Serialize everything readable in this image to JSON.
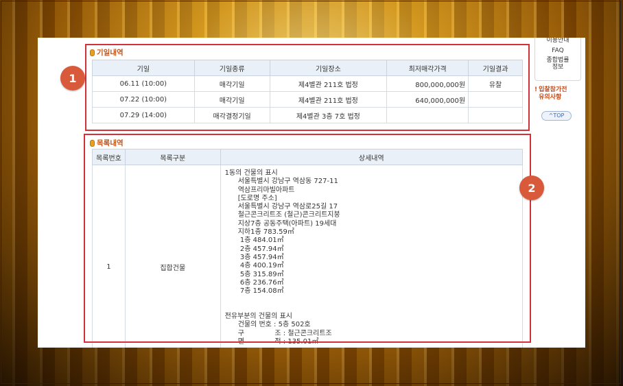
{
  "schedule": {
    "title": "기일내역",
    "headers": [
      "기일",
      "기일종류",
      "기일장소",
      "최저매각가격",
      "기일결과"
    ],
    "rows": [
      [
        "06.11 (10:00)",
        "매각기일",
        "제4별관 211호 법정",
        "800,000,000원",
        "유찰"
      ],
      [
        "07.22 (10:00)",
        "매각기일",
        "제4별관 211호 법정",
        "640,000,000원",
        ""
      ],
      [
        "07.29 (14:00)",
        "매각결정기일",
        "제4별관 3층 7호 법정",
        "",
        ""
      ]
    ]
  },
  "items": {
    "title": "목록내역",
    "headers": [
      "목록번호",
      "목록구분",
      "상세내역"
    ],
    "row": {
      "number": "1",
      "category": "집합건물",
      "detail_lines": [
        "1동의 건물의 표시",
        "      서울특별시 강남구 역삼동 727-11",
        "      역삼프리마빌아파트",
        "      [도로명 주소]",
        "      서울특별시 강남구 역삼로25길 17",
        "      철근콘크리트조 (철근)콘크리트지붕",
        "      지상7층 공동주택(아파트) 19세대",
        "      지하1층 783.59㎡",
        "       1층 484.01㎡",
        "       2층 457.94㎡",
        "       3층 457.94㎡",
        "       4층 400.19㎡",
        "       5층 315.89㎡",
        "       6층 236.76㎡",
        "       7층 154.08㎡",
        "",
        "",
        "전유부분의 건물의 표시",
        "      건물의 번호 : 5층 502호",
        "      구              조 : 철근콘크리트조",
        "      면              적 : 135.01㎡"
      ]
    }
  },
  "quick_menu": {
    "items": [
      "이용안내",
      "FAQ",
      "종합법률\n정보"
    ],
    "notice": "입찰참가전\n유의사항",
    "top_label": "^TOP"
  },
  "annotations": [
    "1",
    "2"
  ],
  "colors": {
    "annotation": "#d2313a",
    "badge": "#d85a3a",
    "section_title": "#c0541a",
    "header_bg": "#eaf0f7"
  }
}
